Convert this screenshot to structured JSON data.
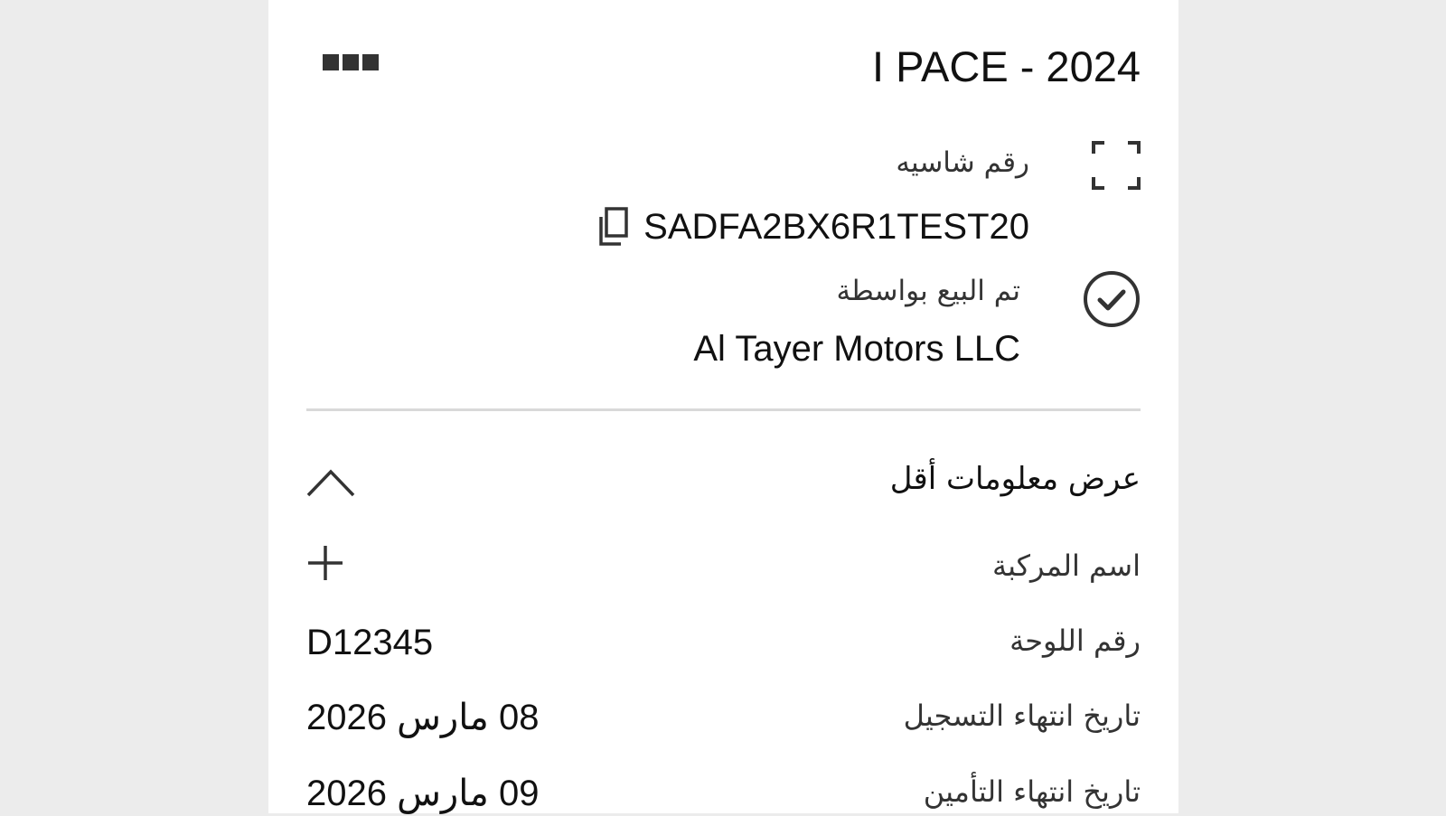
{
  "header": {
    "title": "I PACE - 2024",
    "more_icon": "more-options-icon"
  },
  "vin": {
    "icon": "scan-frame-icon",
    "label": "رقم شاسيه",
    "value": "SADFA2BX6R1TEST20",
    "copy_icon": "copy-icon"
  },
  "seller": {
    "icon": "check-circle-icon",
    "label": "تم البيع بواسطة",
    "value": "Al Tayer Motors LLC"
  },
  "toggle": {
    "label": "عرض معلومات أقل",
    "icon": "chevron-up-icon"
  },
  "details": {
    "vehicle_name": {
      "label": "اسم المركبة",
      "icon": "plus-icon"
    },
    "plate": {
      "label": "رقم اللوحة",
      "value": "D12345"
    },
    "registration_expiry": {
      "label": "تاريخ انتهاء التسجيل",
      "value": "08 مارس 2026"
    },
    "insurance_expiry": {
      "label": "تاريخ انتهاء التأمين",
      "value": "09 مارس 2026"
    }
  }
}
